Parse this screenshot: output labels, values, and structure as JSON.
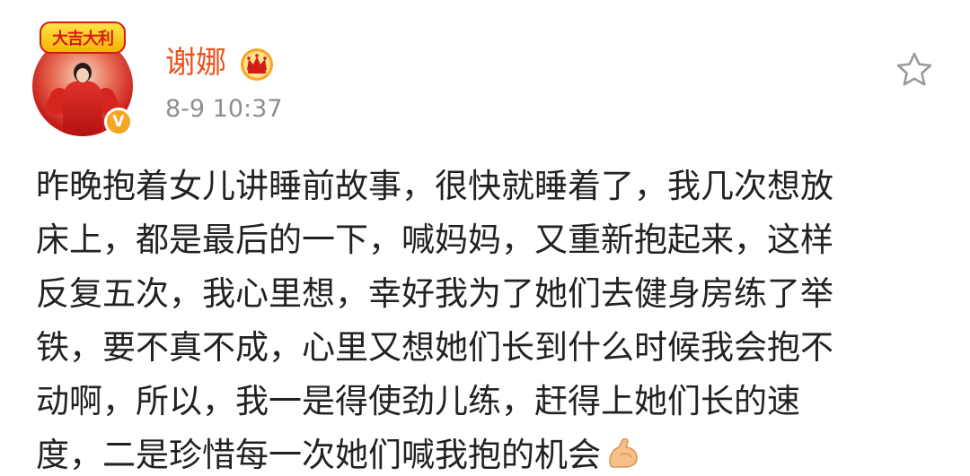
{
  "user": {
    "name": "谢娜",
    "timestamp": "8-9 10:37",
    "avatar_banner": "大吉大利",
    "verified_mark": "V",
    "avatar_icon": "avatar-photo",
    "crown_icon": "crown-icon",
    "verified_icon": "verified-badge-icon"
  },
  "actions": {
    "favorite_icon": "star-outline-icon"
  },
  "post": {
    "lines": [
      "昨晚抱着女儿讲睡前故事，很快就睡着了，我几次想放",
      "床上，都是最后的一下，喊妈妈，又重新抱起来，这样",
      "反复五次，我心里想，幸好我为了她们去健身房练了举",
      "铁，要不真不成，心里又想她们长到什么时候我会抱不",
      "动啊，所以，我一是得使劲儿练，赶得上她们长的速",
      "度，二是珍惜每一次她们喊我抱的机会"
    ],
    "trailing_emoji": "flexed-biceps-icon"
  },
  "colors": {
    "username": "#e8541e",
    "timestamp": "#8e8e8e",
    "body_text": "#222222",
    "crown_gold": "#f5a623",
    "crown_red": "#d21c17",
    "verified_badge": "#f5a623",
    "star_outline": "#9a9a9a"
  }
}
